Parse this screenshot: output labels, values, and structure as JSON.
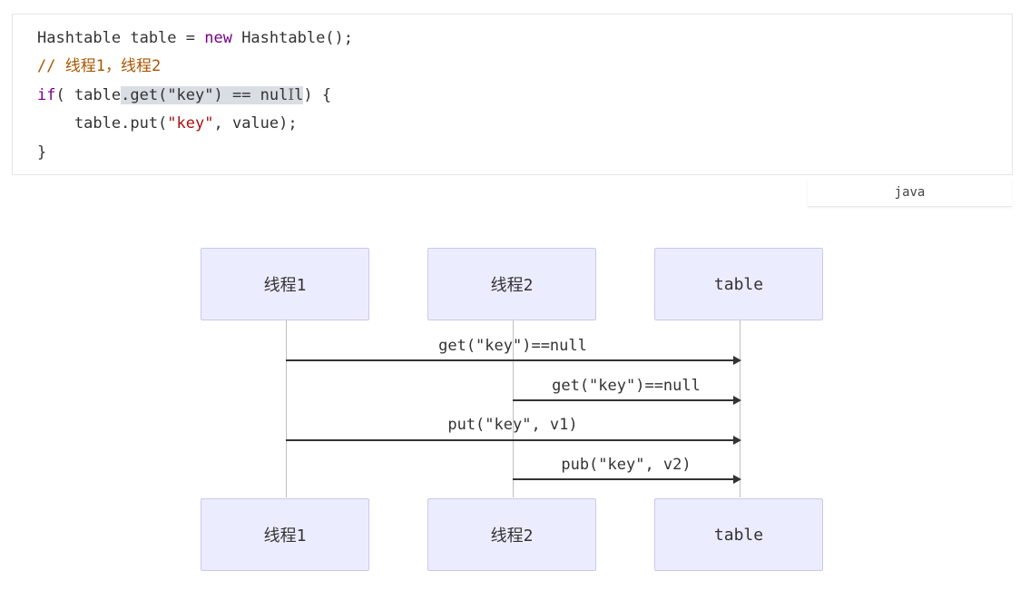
{
  "code": {
    "lines": [
      [
        "Hashtable table = ",
        "new",
        " Hashtable();"
      ],
      [
        "// 线程1，线程2"
      ],
      [
        "if",
        "( table",
        ".get(\"key\") == nul",
        "I",
        "l",
        ") {"
      ],
      [
        "    table.put(",
        "\"key\"",
        ", value);"
      ],
      [
        "}"
      ]
    ],
    "language": "java"
  },
  "diagram": {
    "actors": [
      "线程1",
      "线程2",
      "table"
    ],
    "messages": [
      {
        "from": "线程1",
        "to": "table",
        "label": "get(\"key\")==null"
      },
      {
        "from": "线程2",
        "to": "table",
        "label": "get(\"key\")==null"
      },
      {
        "from": "线程1",
        "to": "table",
        "label": "put(\"key\", v1)"
      },
      {
        "from": "线程2",
        "to": "table",
        "label": "pub(\"key\", v2)"
      }
    ]
  },
  "colors": {
    "actor_fill": "#ECECFF",
    "keyword": "#770088",
    "comment": "#aa5500",
    "string": "#aa1111"
  }
}
